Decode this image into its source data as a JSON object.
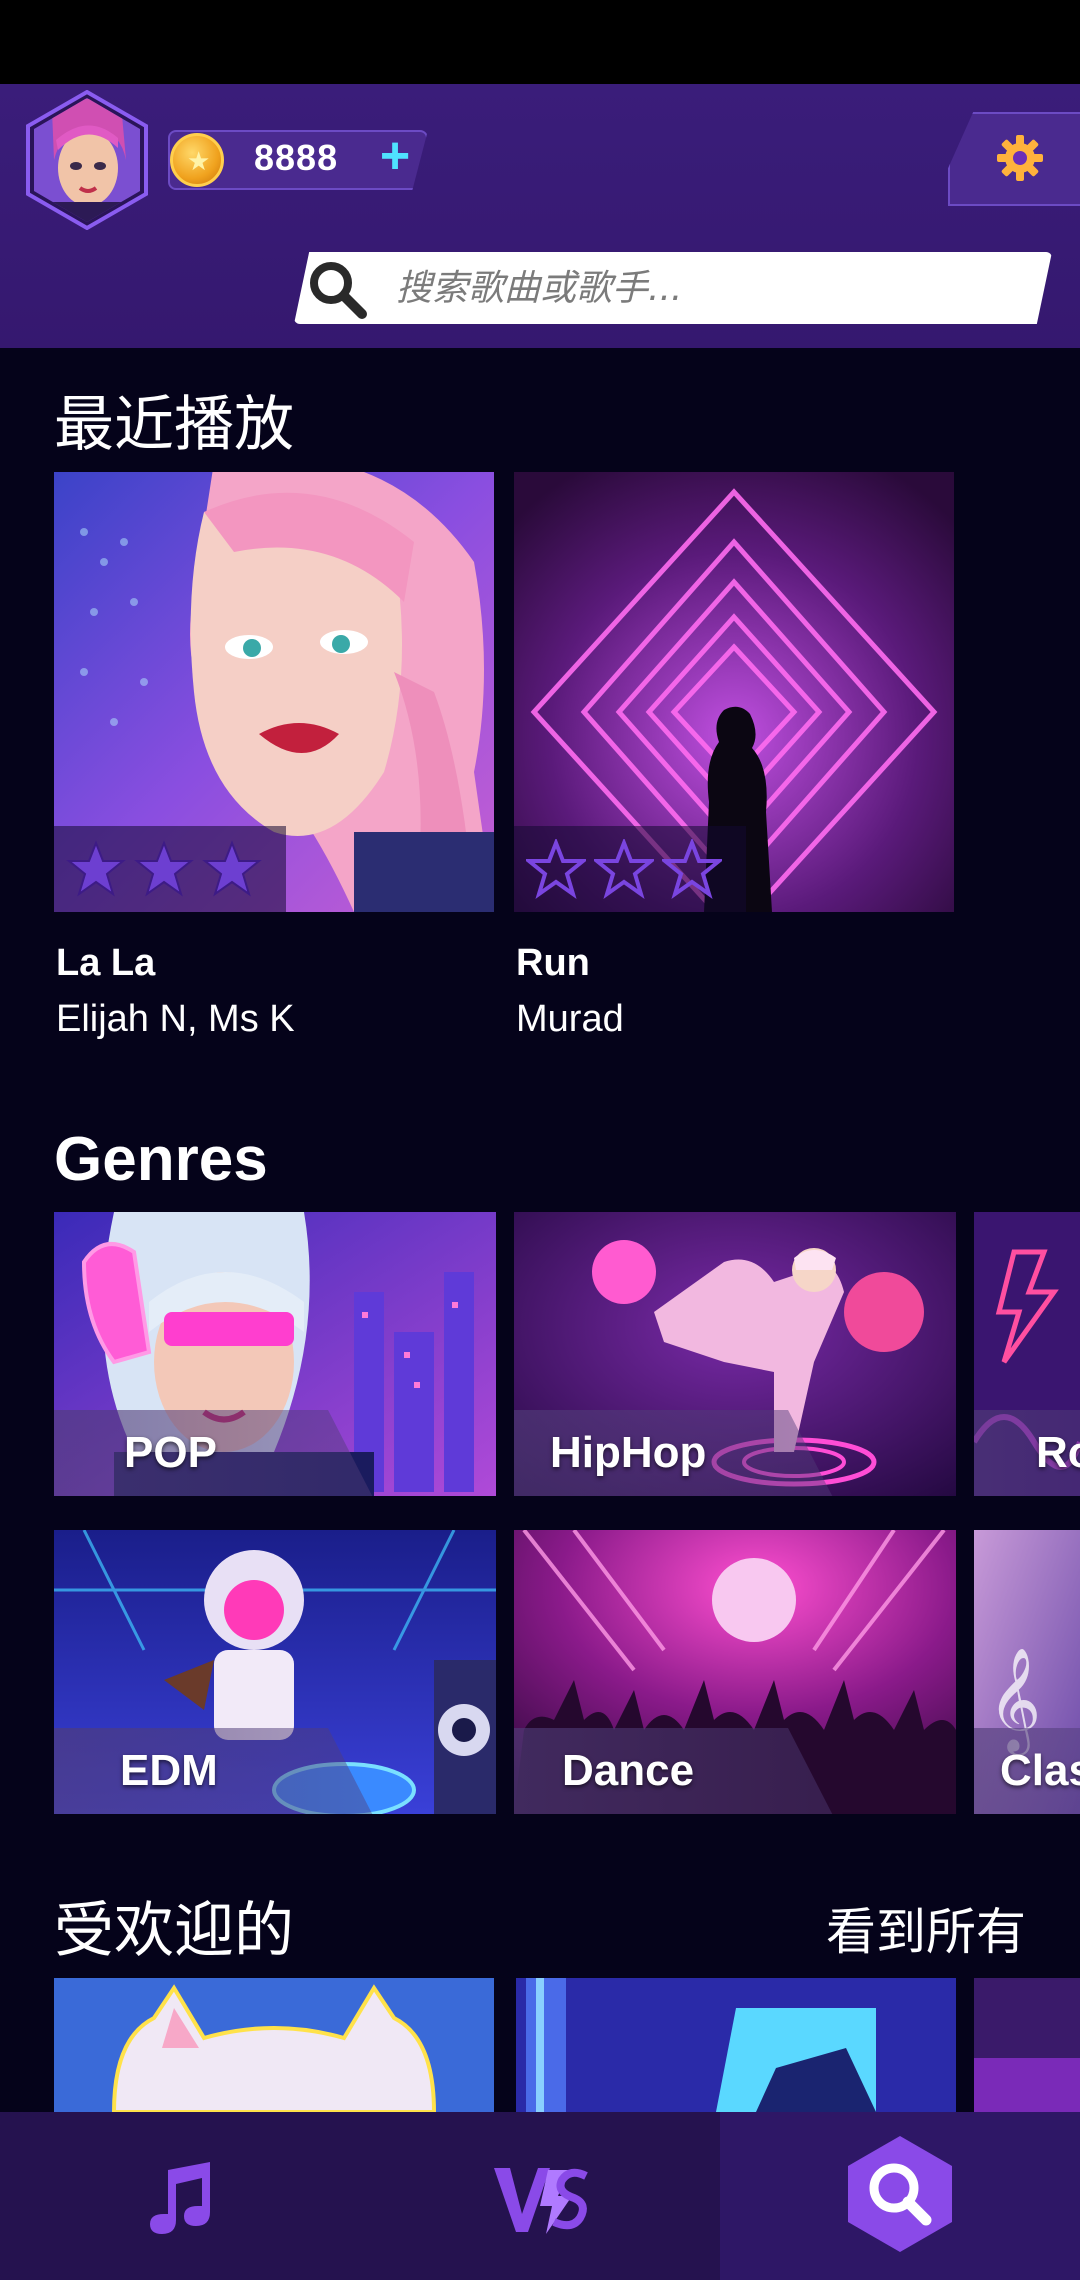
{
  "header": {
    "coins": "8888",
    "search": {
      "placeholder": "搜索歌曲或歌手..."
    }
  },
  "recent": {
    "title": "最近播放",
    "songs": [
      {
        "title": "La La",
        "artist": "Elijah N, Ms K",
        "stars_earned": 3,
        "stars_total": 3
      },
      {
        "title": "Run",
        "artist": "Murad",
        "stars_earned": 0,
        "stars_total": 3
      }
    ]
  },
  "genres": {
    "title": "Genres",
    "items": [
      {
        "label": "POP"
      },
      {
        "label": "HipHop"
      },
      {
        "label": "Ro"
      },
      {
        "label": "EDM"
      },
      {
        "label": "Dance"
      },
      {
        "label": "Clas"
      }
    ]
  },
  "popular": {
    "title": "受欢迎的",
    "see_all": "看到所有"
  },
  "nav": {
    "tabs": [
      {
        "icon": "music-note-icon",
        "active": false
      },
      {
        "icon": "versus-icon",
        "active": false
      },
      {
        "icon": "search-icon",
        "active": true
      }
    ]
  },
  "colors": {
    "header_bg": "#3a1d7a",
    "page_bg": "#05031a",
    "accent_cyan": "#4fe2ff",
    "nav_bg": "#25124f",
    "star_purple": "#6d3fd1"
  }
}
